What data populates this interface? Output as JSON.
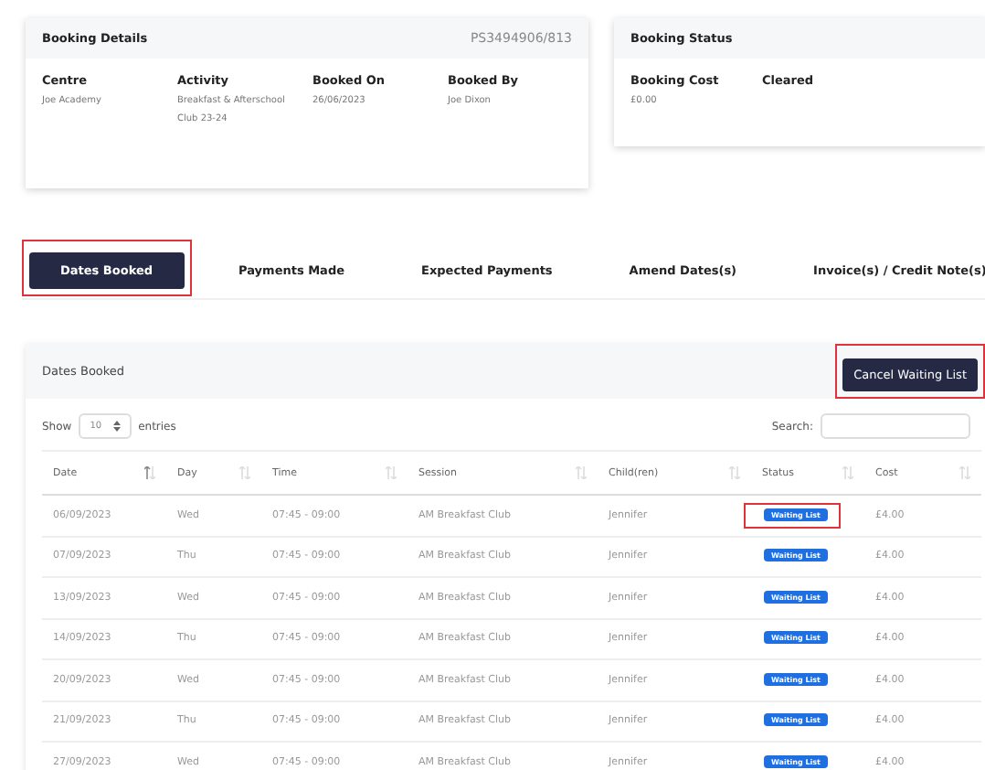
{
  "booking_details": {
    "title": "Booking Details",
    "reference": "PS3494906/813",
    "fields": [
      {
        "label": "Centre",
        "value": "Joe Academy"
      },
      {
        "label": "Activity",
        "value": "Breakfast & Afterschool Club 23-24"
      },
      {
        "label": "Booked On",
        "value": "26/06/2023"
      },
      {
        "label": "Booked By",
        "value": "Joe Dixon"
      }
    ]
  },
  "booking_status": {
    "title": "Booking Status",
    "fields": [
      {
        "label": "Booking Cost",
        "value": "£0.00"
      },
      {
        "label": "Cleared"
      }
    ]
  },
  "tabs": [
    {
      "label": "Dates Booked",
      "selected": true,
      "highlighted": true
    },
    {
      "label": "Payments Made",
      "selected": false,
      "highlighted": false
    },
    {
      "label": "Expected Payments",
      "selected": false,
      "highlighted": false
    },
    {
      "label": "Amend Dates(s)",
      "selected": false,
      "highlighted": false
    },
    {
      "label": "Invoice(s) / Credit Note(s)",
      "selected": false,
      "highlighted": false
    }
  ],
  "panel": {
    "title": "Dates Booked",
    "action_button": {
      "label": "Cancel Waiting List",
      "highlighted": true
    },
    "length": {
      "before": "Show",
      "value": "10",
      "after": "entries"
    },
    "search_label": "Search:",
    "table": {
      "columns": [
        {
          "label": "Date",
          "sorted": true
        },
        {
          "label": "Day",
          "sorted": false
        },
        {
          "label": "Time",
          "sorted": false
        },
        {
          "label": "Session",
          "sorted": false
        },
        {
          "label": "Child(ren)",
          "sorted": false
        },
        {
          "label": "Status",
          "sorted": false
        },
        {
          "label": "Cost",
          "sorted": false
        }
      ],
      "rows": [
        {
          "cells": [
            "06/09/2023",
            "Wed",
            "07:45 - 09:00",
            "AM Breakfast Club",
            "Jennifer"
          ],
          "status": "Waiting List",
          "cost": "£4.00",
          "highlighted": true
        },
        {
          "cells": [
            "07/09/2023",
            "Thu",
            "07:45 - 09:00",
            "AM Breakfast Club",
            "Jennifer"
          ],
          "status": "Waiting List",
          "cost": "£4.00",
          "highlighted": false
        },
        {
          "cells": [
            "13/09/2023",
            "Wed",
            "07:45 - 09:00",
            "AM Breakfast Club",
            "Jennifer"
          ],
          "status": "Waiting List",
          "cost": "£4.00",
          "highlighted": false
        },
        {
          "cells": [
            "14/09/2023",
            "Thu",
            "07:45 - 09:00",
            "AM Breakfast Club",
            "Jennifer"
          ],
          "status": "Waiting List",
          "cost": "£4.00",
          "highlighted": false
        },
        {
          "cells": [
            "20/09/2023",
            "Wed",
            "07:45 - 09:00",
            "AM Breakfast Club",
            "Jennifer"
          ],
          "status": "Waiting List",
          "cost": "£4.00",
          "highlighted": false
        },
        {
          "cells": [
            "21/09/2023",
            "Thu",
            "07:45 - 09:00",
            "AM Breakfast Club",
            "Jennifer"
          ],
          "status": "Waiting List",
          "cost": "£4.00",
          "highlighted": false
        },
        {
          "cells": [
            "27/09/2023",
            "Wed",
            "07:45 - 09:00",
            "AM Breakfast Club",
            "Jennifer"
          ],
          "status": "Waiting List",
          "cost": "£4.00",
          "highlighted": false
        }
      ]
    }
  }
}
